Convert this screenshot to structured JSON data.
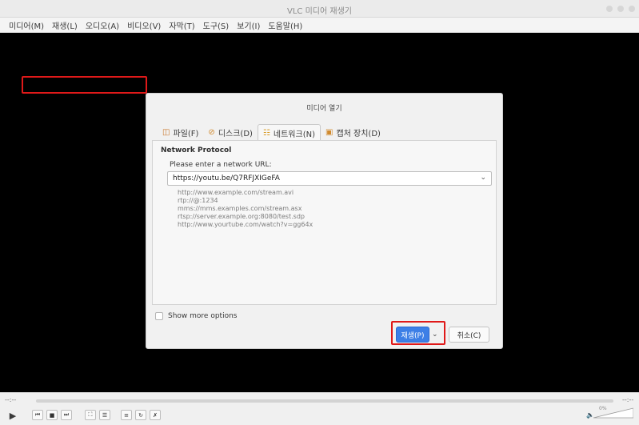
{
  "window": {
    "title": "VLC 미디어 재생기"
  },
  "menubar": {
    "items": [
      {
        "label": "미디어(M)"
      },
      {
        "label": "재생(L)"
      },
      {
        "label": "오디오(A)"
      },
      {
        "label": "비디오(V)"
      },
      {
        "label": "자막(T)"
      },
      {
        "label": "도구(S)"
      },
      {
        "label": "보기(I)"
      },
      {
        "label": "도움말(H)"
      }
    ]
  },
  "dialog": {
    "title": "미디어 열기",
    "tabs": [
      {
        "label": "파일(F)",
        "icon": "file-icon"
      },
      {
        "label": "디스크(D)",
        "icon": "disc-icon"
      },
      {
        "label": "네트워크(N)",
        "icon": "network-icon",
        "active": true
      },
      {
        "label": "캡처 장치(D)",
        "icon": "capture-device-icon"
      }
    ],
    "network": {
      "heading": "Network Protocol",
      "url_label": "Please enter a network URL:",
      "url_value": "https://youtu.be/Q7RFJXIGeFA",
      "examples": [
        "http://www.example.com/stream.avi",
        "rtp://@:1234",
        "mms://mms.examples.com/stream.asx",
        "rtsp://server.example.org:8080/test.sdp",
        "http://www.yourtube.com/watch?v=gg64x"
      ]
    },
    "show_more_options": {
      "label": "Show more options",
      "checked": false
    },
    "play_button": "재생(P)",
    "cancel_button": "취소(C)"
  },
  "controls": {
    "time_elapsed": "--:--",
    "time_total": "--:--",
    "volume": "0%",
    "seek_progress": 0
  },
  "colors": {
    "accent": "#3d7fe6",
    "highlight": "#e01919",
    "video_bg": "#000000"
  }
}
